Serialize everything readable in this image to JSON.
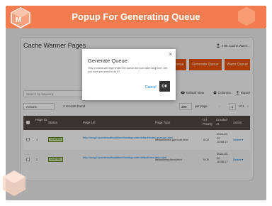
{
  "banner": {
    "title": "Popup For Generating Queue",
    "color": "#f07c4f"
  },
  "header": {
    "page_title": "Cache Warmer Pages",
    "user_name": "TNK Cache Warm...",
    "user_icon": "user-icon",
    "buttons": {
      "generate_queue": "Generate Queue",
      "warm_queue": "Warm Queue",
      "partial_label": "Queue"
    },
    "accent_color": "#eb5202"
  },
  "toolbar": {
    "search_placeholder": "Search by keyword",
    "default_view": "Default View",
    "columns": "Columns",
    "export": "Export"
  },
  "pager": {
    "actions": "Actions",
    "records": "2 records found",
    "per_page_value": "200",
    "per_page_label": "per page",
    "page_value": "1",
    "page_of": "of 1"
  },
  "grid": {
    "columns": [
      "",
      "Page ID",
      "Status",
      "Page Url",
      "Page Type",
      "Url Priority",
      "Created At",
      "Action"
    ],
    "rows": [
      {
        "id": "1",
        "status": "CACHED",
        "url": "http://mag2.spanishsoftaddition/thesitspro/de/default/index.gum.ser.html",
        "type": "default/index.gum.ser.html",
        "priority": "0.00",
        "created": "2024-03-20 10:58:17",
        "action": "Select"
      },
      {
        "id": "2",
        "status": "CACHED",
        "url": "http://mag2.spanishsoftaddition/thesitspro/de/default/new.item.html",
        "type": "default/new.item.html",
        "priority": "0.00",
        "created": "2024-03-20 10:58:17",
        "action": "Select"
      }
    ]
  },
  "modal": {
    "title": "Generate Queue",
    "text": "This process will regenerate the queue and can take long time, are you sure you want to do it?",
    "cancel": "Cancel",
    "ok": "OK",
    "close_icon": "close-icon"
  }
}
